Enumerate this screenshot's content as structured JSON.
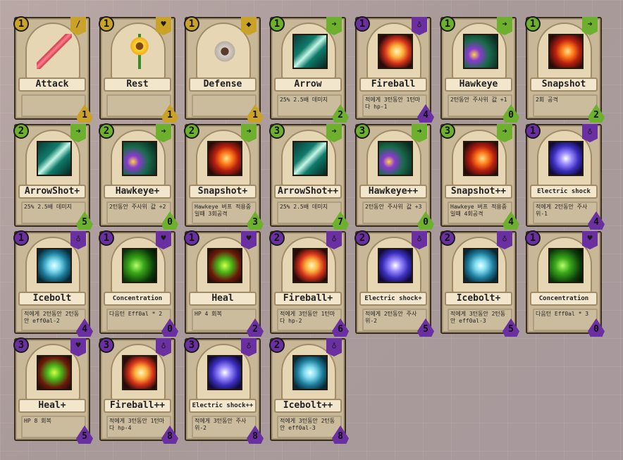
{
  "colors": {
    "gold": "#c9a227",
    "green": "#6db02e",
    "purple": "#6a2fa0"
  },
  "cards": [
    {
      "name": "Attack",
      "desc": "",
      "cost": "1",
      "color": "gold",
      "tag_icon": "sword-icon",
      "tag_glyph": "/",
      "level": "1",
      "art": "sword"
    },
    {
      "name": "Rest",
      "desc": "",
      "cost": "1",
      "color": "gold",
      "tag_icon": "heart-icon",
      "tag_glyph": "♥",
      "level": "1",
      "art": "flower"
    },
    {
      "name": "Defense",
      "desc": "",
      "cost": "1",
      "color": "gold",
      "tag_icon": "shield-icon",
      "tag_glyph": "◆",
      "level": "1",
      "art": "shield"
    },
    {
      "name": "Arrow",
      "desc": "25% 2.5배 데미지",
      "cost": "1",
      "color": "green",
      "tag_icon": "arrow-icon",
      "tag_glyph": "➜",
      "level": "2",
      "art": "arrow"
    },
    {
      "name": "Fireball",
      "desc": "적에게 3턴동안 1턴마다 hp-1",
      "cost": "1",
      "color": "purple",
      "tag_icon": "potion-icon",
      "tag_glyph": "♁",
      "level": "4",
      "art": "fire"
    },
    {
      "name": "Hawkeye",
      "desc": "2턴동안 주사위 값 +1",
      "cost": "1",
      "color": "green",
      "tag_icon": "arrow-icon",
      "tag_glyph": "➜",
      "level": "0",
      "art": "hawk"
    },
    {
      "name": "Snapshot",
      "desc": "2회 공격",
      "cost": "1",
      "color": "green",
      "tag_icon": "arrow-icon",
      "tag_glyph": "➜",
      "level": "2",
      "art": "snap"
    },
    {
      "name": "ArrowShot+",
      "desc": "25% 2.5배 데미지",
      "cost": "2",
      "color": "green",
      "tag_icon": "arrow-icon",
      "tag_glyph": "➜",
      "level": "5",
      "art": "arrow"
    },
    {
      "name": "Hawkeye+",
      "desc": "2턴동안 주사위 값 +2",
      "cost": "2",
      "color": "green",
      "tag_icon": "arrow-icon",
      "tag_glyph": "➜",
      "level": "0",
      "art": "hawk"
    },
    {
      "name": "Snapshot+",
      "desc": "Hawkeye 버프 적용중일때 3회공격",
      "cost": "2",
      "color": "green",
      "tag_icon": "arrow-icon",
      "tag_glyph": "➜",
      "level": "3",
      "art": "snap"
    },
    {
      "name": "ArrowShot++",
      "desc": "25% 2.5배 데미지",
      "cost": "3",
      "color": "green",
      "tag_icon": "arrow-icon",
      "tag_glyph": "➜",
      "level": "7",
      "art": "arrow"
    },
    {
      "name": "Hawkeye++",
      "desc": "2턴동안 주사위 값 +3",
      "cost": "3",
      "color": "green",
      "tag_icon": "arrow-icon",
      "tag_glyph": "➜",
      "level": "0",
      "art": "hawk"
    },
    {
      "name": "Snapshot++",
      "desc": "Hawkeye 버프 적용중일때 4회공격",
      "cost": "3",
      "color": "green",
      "tag_icon": "arrow-icon",
      "tag_glyph": "➜",
      "level": "4",
      "art": "snap"
    },
    {
      "name": "Electric shock",
      "desc": "적에게 2턴동안 주사위-1",
      "cost": "1",
      "color": "purple",
      "tag_icon": "potion-icon",
      "tag_glyph": "♁",
      "level": "4",
      "art": "electric"
    },
    {
      "name": "Icebolt",
      "desc": "적에게 2턴동안 2턴동안 eff0al-2",
      "cost": "1",
      "color": "purple",
      "tag_icon": "potion-icon",
      "tag_glyph": "♁",
      "level": "4",
      "art": "ice"
    },
    {
      "name": "Concentration",
      "desc": "다음턴 Eff0al * 2",
      "cost": "1",
      "color": "purple",
      "tag_icon": "heart-icon",
      "tag_glyph": "♥",
      "level": "0",
      "art": "conc"
    },
    {
      "name": "Heal",
      "desc": "HP 4 회복",
      "cost": "1",
      "color": "purple",
      "tag_icon": "heart-icon",
      "tag_glyph": "♥",
      "level": "2",
      "art": "heal"
    },
    {
      "name": "Fireball+",
      "desc": "적에게 3턴동안 1턴마다 hp-2",
      "cost": "2",
      "color": "purple",
      "tag_icon": "potion-icon",
      "tag_glyph": "♁",
      "level": "6",
      "art": "fire"
    },
    {
      "name": "Electric shock+",
      "desc": "적에게 2턴동안 주사위-2",
      "cost": "2",
      "color": "purple",
      "tag_icon": "potion-icon",
      "tag_glyph": "♁",
      "level": "5",
      "art": "electric"
    },
    {
      "name": "Icebolt+",
      "desc": "적에게 3턴동안 2턴동안 eff0al-3",
      "cost": "2",
      "color": "purple",
      "tag_icon": "potion-icon",
      "tag_glyph": "♁",
      "level": "5",
      "art": "ice"
    },
    {
      "name": "Concentration",
      "desc": "다음턴 Eff0al * 3",
      "cost": "1",
      "color": "purple",
      "tag_icon": "heart-icon",
      "tag_glyph": "♥",
      "level": "0",
      "art": "conc"
    },
    {
      "name": "Heal+",
      "desc": "HP 8 회복",
      "cost": "3",
      "color": "purple",
      "tag_icon": "heart-icon",
      "tag_glyph": "♥",
      "level": "5",
      "art": "heal"
    },
    {
      "name": "Fireball++",
      "desc": "적에게 3턴동안 1턴마다 hp-4",
      "cost": "3",
      "color": "purple",
      "tag_icon": "potion-icon",
      "tag_glyph": "♁",
      "level": "8",
      "art": "fire"
    },
    {
      "name": "Electric shock++",
      "desc": "적에게 3턴동안 주사위-2",
      "cost": "3",
      "color": "purple",
      "tag_icon": "potion-icon",
      "tag_glyph": "♁",
      "level": "8",
      "art": "electric"
    },
    {
      "name": "Icebolt++",
      "desc": "적에게 3턴동안 2턴동안 eff0al-3",
      "cost": "2",
      "color": "purple",
      "tag_icon": "potion-icon",
      "tag_glyph": "♁",
      "level": "8",
      "art": "ice"
    }
  ]
}
